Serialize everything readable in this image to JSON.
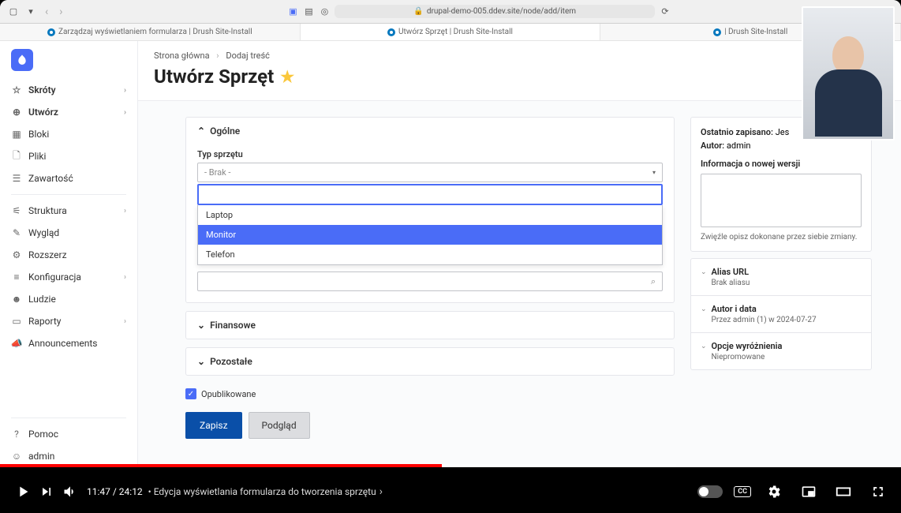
{
  "browser": {
    "url": "drupal-demo-005.ddev.site/node/add/item",
    "tabs": [
      {
        "label": "Zarządzaj wyświetlaniem formularza | Drush Site-Install"
      },
      {
        "label": "Utwórz Sprzęt | Drush Site-Install"
      },
      {
        "label": "| Drush Site-Install"
      }
    ]
  },
  "sidebar": {
    "items": [
      {
        "label": "Skróty",
        "bold": true,
        "chev": true,
        "icon": "star"
      },
      {
        "label": "Utwórz",
        "bold": true,
        "chev": true,
        "icon": "plus"
      },
      {
        "label": "Bloki",
        "icon": "blocks"
      },
      {
        "label": "Pliki",
        "icon": "file"
      },
      {
        "label": "Zawartość",
        "icon": "list"
      },
      {
        "sep": true
      },
      {
        "label": "Struktura",
        "chev": true,
        "icon": "tree"
      },
      {
        "label": "Wygląd",
        "icon": "brush"
      },
      {
        "label": "Rozszerz",
        "icon": "plug"
      },
      {
        "label": "Konfiguracja",
        "chev": true,
        "icon": "sliders"
      },
      {
        "label": "Ludzie",
        "icon": "people"
      },
      {
        "label": "Raporty",
        "chev": true,
        "icon": "chart"
      },
      {
        "label": "Announcements",
        "icon": "mega"
      }
    ],
    "help": "Pomoc",
    "admin": "admin"
  },
  "breadcrumb": {
    "home": "Strona główna",
    "add": "Dodaj treść"
  },
  "page_title": "Utwórz Sprzęt",
  "form": {
    "fieldset1": "Ogólne",
    "type_label": "Typ sprzętu",
    "type_placeholder": "- Brak -",
    "options": [
      "Laptop",
      "Monitor",
      "Telefon"
    ],
    "fieldset2": "Finansowe",
    "fieldset3": "Pozostałe",
    "published": "Opublikowane",
    "save": "Zapisz",
    "preview": "Podgląd"
  },
  "panel": {
    "last_saved_label": "Ostatnio zapisano:",
    "last_saved_value": "Jes",
    "author_label": "Autor:",
    "author_value": "admin",
    "revision_label": "Informacja o nowej wersji",
    "revision_help": "Zwięźle opisz dokonane przez siebie zmiany.",
    "acc": [
      {
        "title": "Alias URL",
        "sub": "Brak aliasu"
      },
      {
        "title": "Autor i data",
        "sub": "Przez admin (1) w 2024-07-27"
      },
      {
        "title": "Opcje wyróżnienia",
        "sub": "Niepromowane"
      }
    ]
  },
  "player": {
    "current": "11:47",
    "total": "24:12",
    "chapter": "Edycja wyświetlania formularza do tworzenia sprzętu",
    "cc": "CC"
  }
}
